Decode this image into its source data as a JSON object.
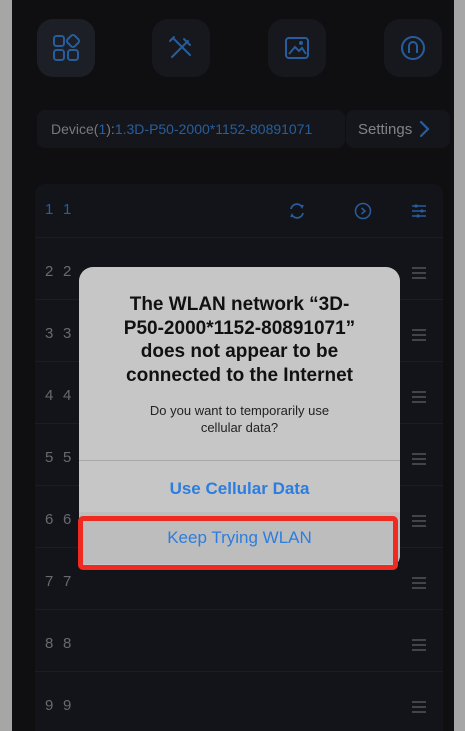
{
  "topbar": {
    "icons": [
      "grid-icon",
      "tools-icon",
      "image-icon",
      "profile-icon"
    ]
  },
  "device": {
    "prefix": "Device(",
    "count": "1",
    "suffix": "): ",
    "name": "1.3D-P50-2000*1152-80891071",
    "settings_label": "Settings"
  },
  "list": {
    "rows": [
      {
        "a": "1",
        "b": "1"
      },
      {
        "a": "2",
        "b": "2"
      },
      {
        "a": "3",
        "b": "3"
      },
      {
        "a": "4",
        "b": "4"
      },
      {
        "a": "5",
        "b": "5"
      },
      {
        "a": "6",
        "b": "6"
      },
      {
        "a": "7",
        "b": "7"
      },
      {
        "a": "8",
        "b": "8"
      },
      {
        "a": "9",
        "b": "9"
      }
    ]
  },
  "alert": {
    "title_line1": "The WLAN network “3D-",
    "title_line2": "P50-2000*1152-80891071”",
    "title_line3": "does not appear to be",
    "title_line4": "connected to the Internet",
    "message_line1": "Do you want to temporarily use",
    "message_line2": "cellular data?",
    "primary_label": "Use Cellular Data",
    "secondary_label": "Keep Trying WLAN"
  },
  "colors": {
    "accent": "#3d8ff0",
    "highlight": "#ef2a20",
    "background": "#17181d"
  }
}
